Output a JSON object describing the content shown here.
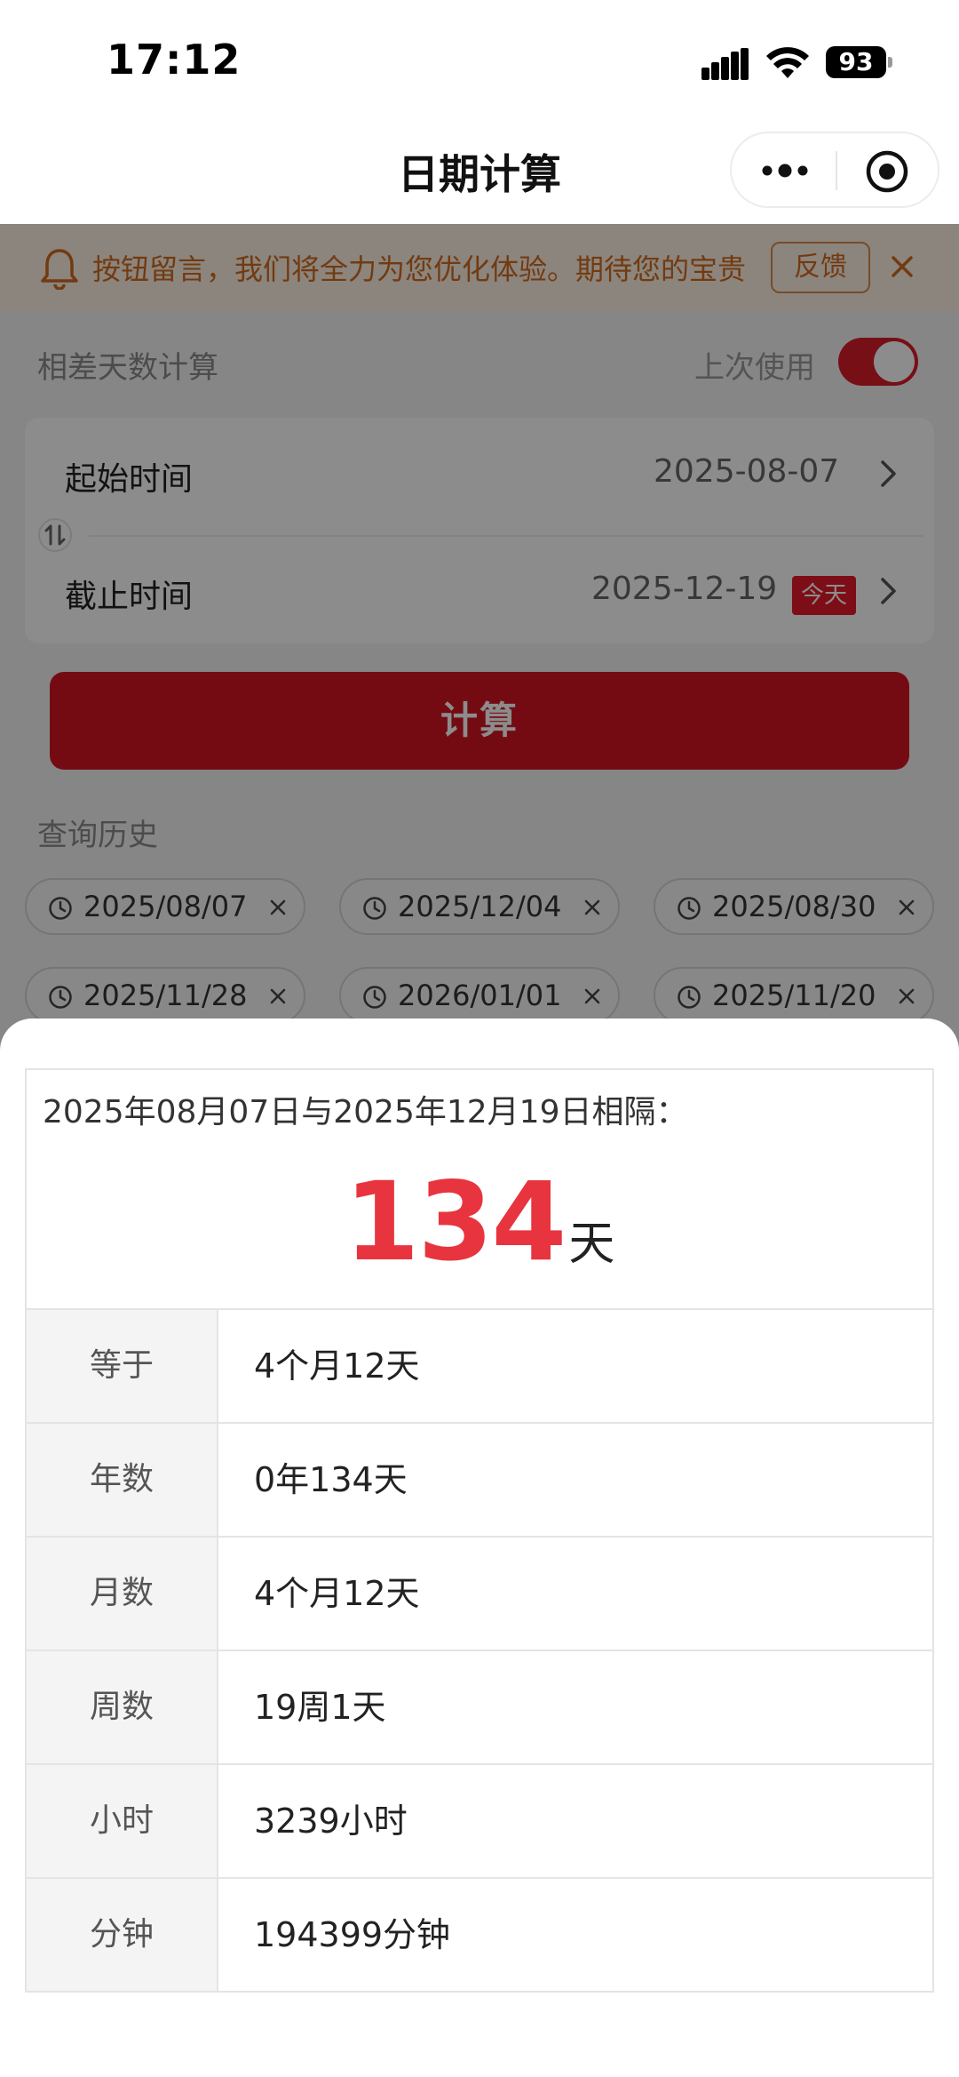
{
  "status_bar": {
    "time": "17:12",
    "battery": "93"
  },
  "nav": {
    "title": "日期计算"
  },
  "notice": {
    "text": "按钮留言，我们将全力为您优化体验。期待您的宝贵",
    "feedback_label": "反馈"
  },
  "calc_section": {
    "title": "相差天数计算",
    "last_used_label": "上次使用",
    "toggle_on": true
  },
  "start": {
    "label": "起始时间",
    "value": "2025-08-07"
  },
  "end": {
    "label": "截止时间",
    "value": "2025-12-19",
    "badge": "今天"
  },
  "calc_button": "计算",
  "history": {
    "title": "查询历史",
    "chips": [
      "2025/08/07",
      "2025/12/04",
      "2025/08/30",
      "2025/11/28",
      "2026/01/01",
      "2025/11/20"
    ]
  },
  "result": {
    "header": "2025年08月07日与2025年12月19日相隔：",
    "number": "134",
    "unit": "天",
    "rows": [
      {
        "label": "等于",
        "value": "4个月12天"
      },
      {
        "label": "年数",
        "value": "0年134天"
      },
      {
        "label": "月数",
        "value": "4个月12天"
      },
      {
        "label": "周数",
        "value": "19周1天"
      },
      {
        "label": "小时",
        "value": "3239小时"
      },
      {
        "label": "分钟",
        "value": "194399分钟"
      }
    ]
  },
  "colors": {
    "accent": "#d61522",
    "result_number": "#e8343e",
    "notice_text": "#d26a1f"
  }
}
